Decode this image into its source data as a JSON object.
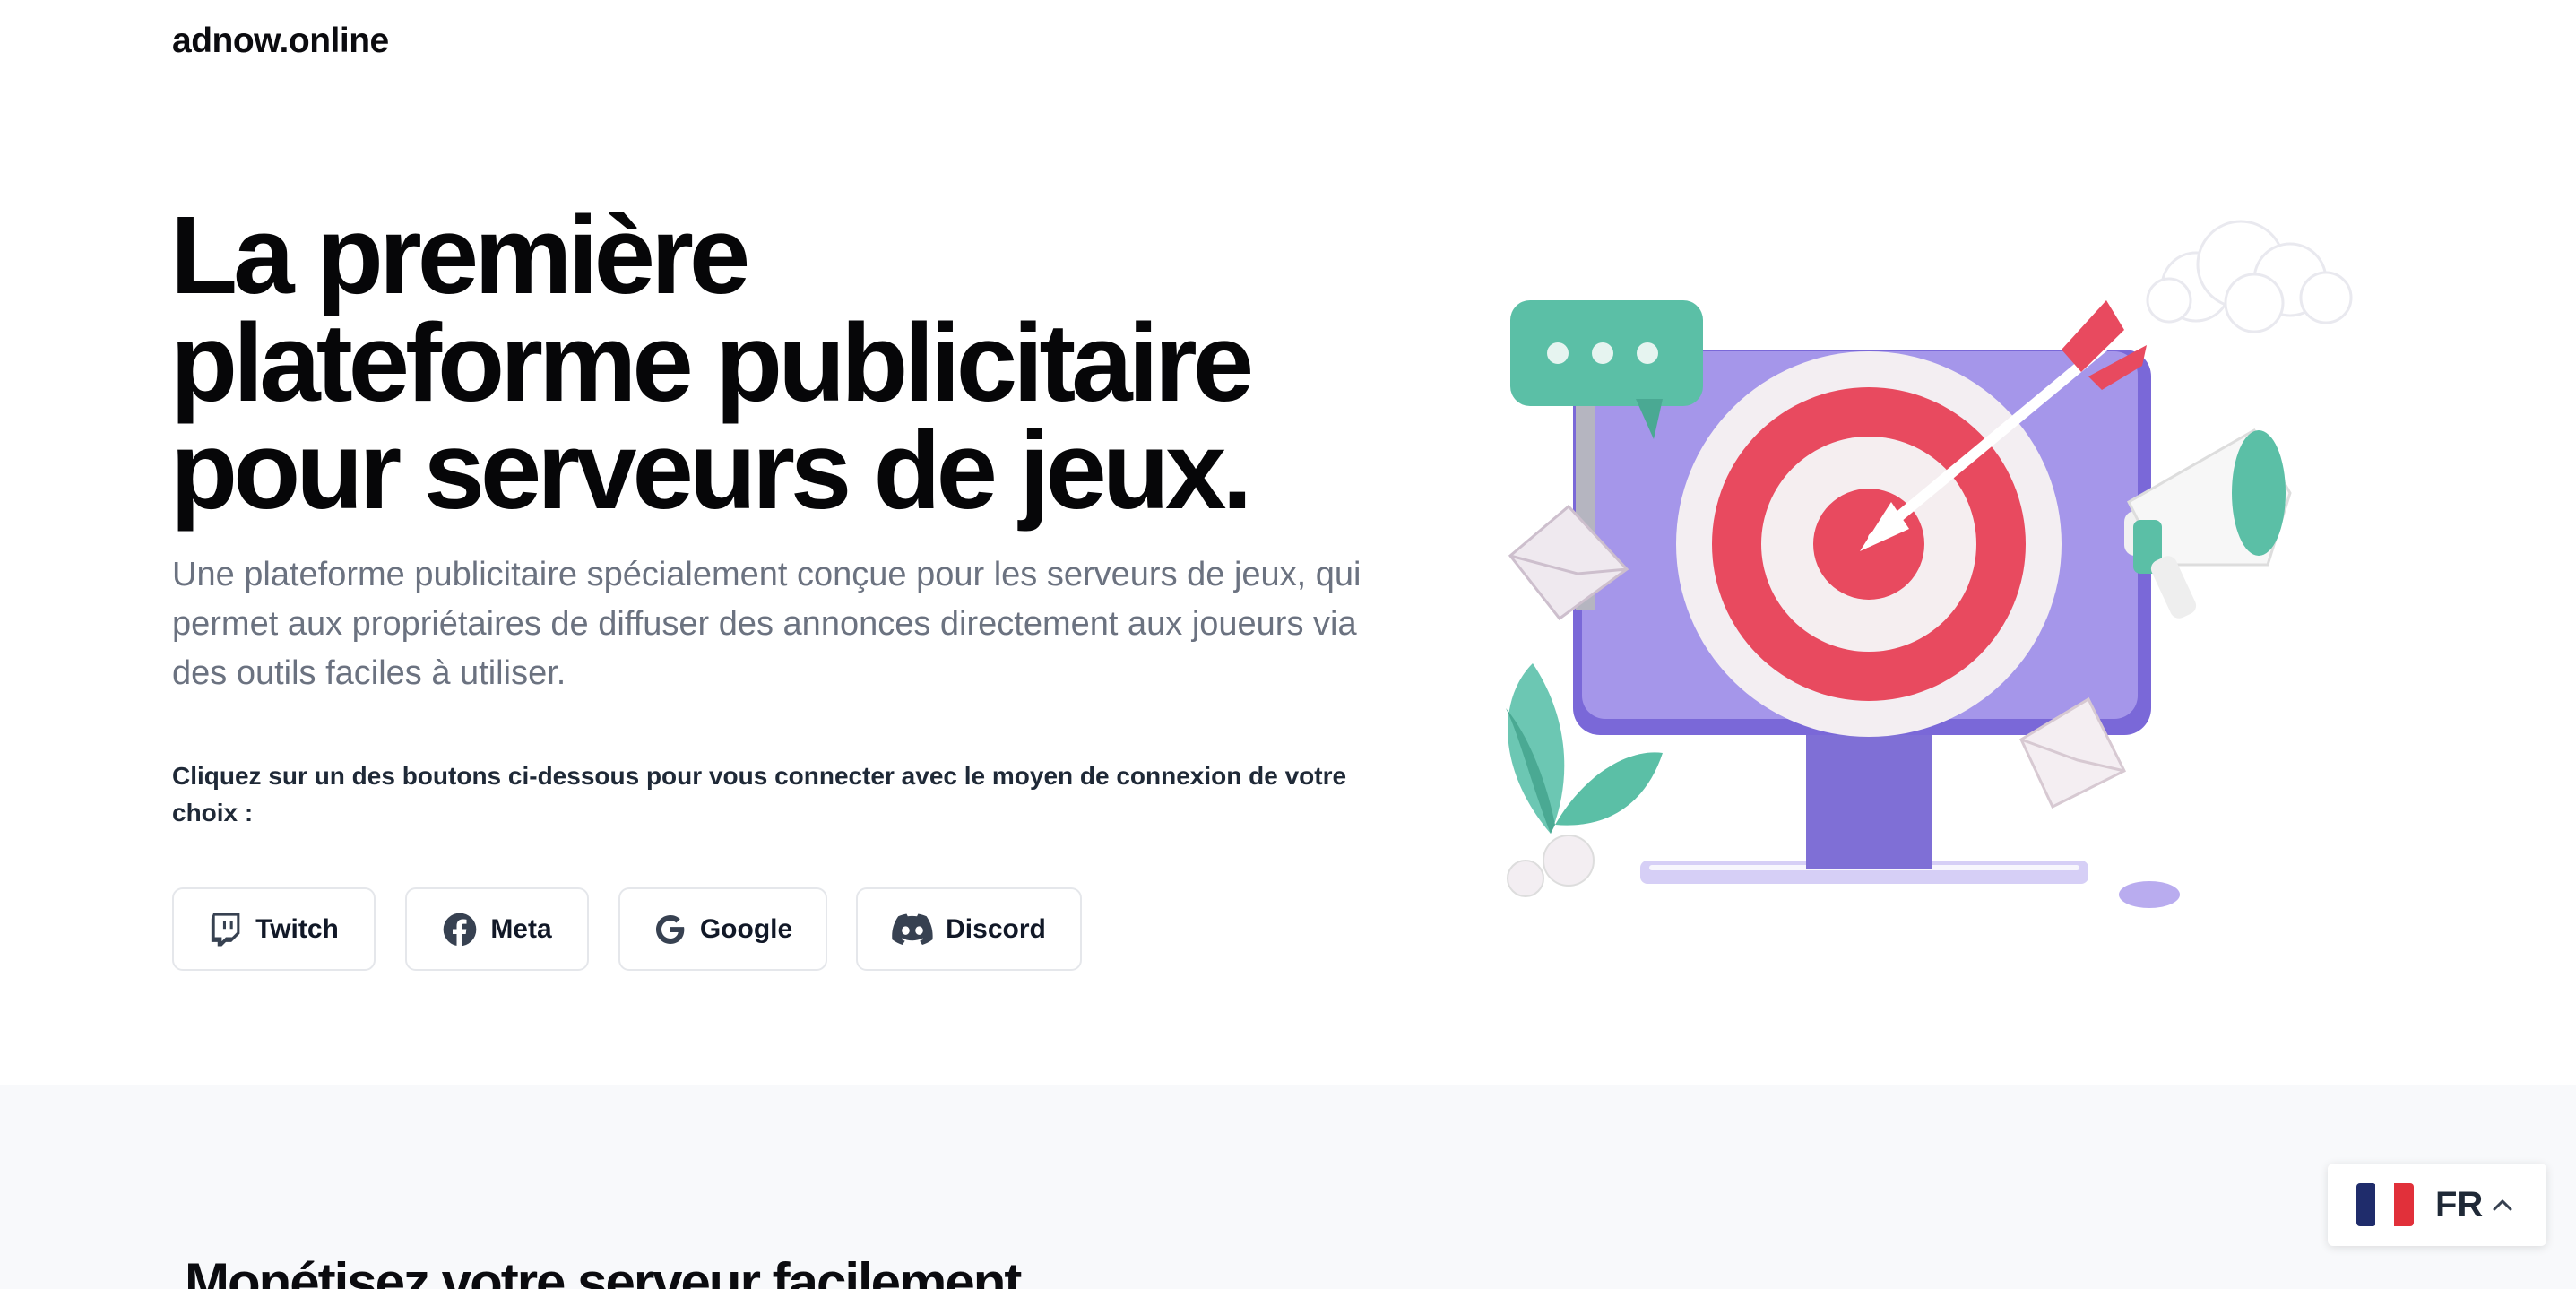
{
  "header": {
    "brand": "adnow.online"
  },
  "hero": {
    "title_lines": [
      "La première",
      "plateforme publicitaire",
      "pour serveurs de jeux."
    ],
    "description": "Une plateforme publicitaire spécialement conçue pour les serveurs de jeux, qui permet aux propriétaires de diffuser des annonces directement aux joueurs via des outils faciles à utiliser.",
    "connect_prompt": "Cliquez sur un des boutons ci-dessous pour vous connecter avec le moyen de connexion de votre choix :"
  },
  "login_buttons": [
    {
      "label": "Twitch",
      "icon": "twitch-icon"
    },
    {
      "label": "Meta",
      "icon": "facebook-icon"
    },
    {
      "label": "Google",
      "icon": "google-icon"
    },
    {
      "label": "Discord",
      "icon": "discord-icon"
    }
  ],
  "illustration": {
    "icon": "target-monitor-illustration"
  },
  "next_section": {
    "heading": "Monétisez votre serveur facilement"
  },
  "language_switcher": {
    "code": "FR",
    "icon": "france-flag-icon",
    "chevron": "chevron-up-icon"
  },
  "colors": {
    "text_primary": "#060608",
    "text_muted": "#6b7280",
    "button_border": "#e5e7eb",
    "section_bg": "#f8f9fb",
    "monitor_purple": "#8f7fe0",
    "target_red": "#e84a5f",
    "accent_teal": "#5bbfa6"
  }
}
